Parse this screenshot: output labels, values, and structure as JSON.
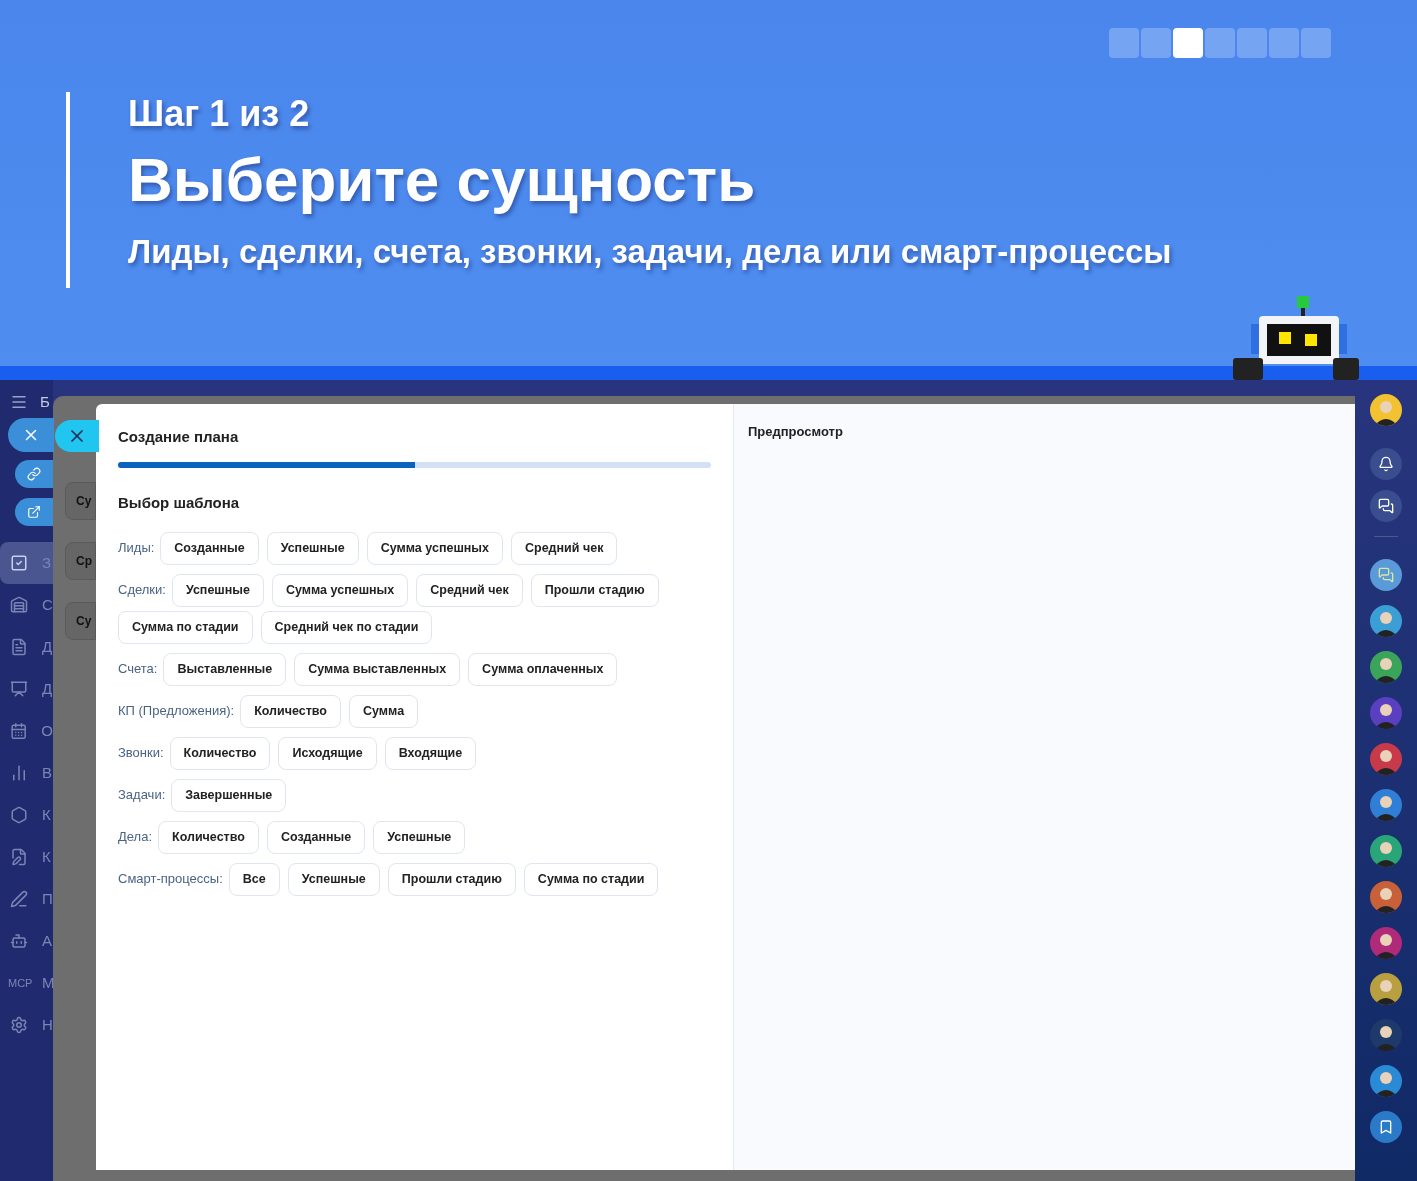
{
  "banner": {
    "step": "Шаг 1 из 2",
    "title": "Выберите сущность",
    "subtitle": "Лиды, сделки, счета, звонки, задачи, дела или смарт-процессы",
    "slides": [
      {
        "selected": false
      },
      {
        "selected": false
      },
      {
        "selected": true
      },
      {
        "selected": false
      },
      {
        "selected": false
      },
      {
        "selected": false
      },
      {
        "selected": false
      }
    ]
  },
  "sidebar": {
    "header": "Б",
    "items": [
      {
        "label": "З",
        "selected": true
      },
      {
        "label": "С",
        "selected": false
      },
      {
        "label": "Д",
        "selected": false
      },
      {
        "label": "Д",
        "selected": false
      },
      {
        "label": "О",
        "selected": false
      },
      {
        "label": "В",
        "selected": false
      },
      {
        "label": "К",
        "selected": false
      },
      {
        "label": "К",
        "selected": false
      },
      {
        "label": "П",
        "selected": false
      },
      {
        "label": "А",
        "selected": false
      },
      {
        "label": "М",
        "icon_text": "MCP",
        "selected": false
      },
      {
        "label": "Н",
        "selected": false
      }
    ]
  },
  "background_cards": [
    "Су",
    "Ср",
    "Су"
  ],
  "modal": {
    "title": "Создание плана",
    "progress": {
      "level": 0.5
    },
    "section": "Выбор шаблона",
    "groups": [
      {
        "label": "Лиды:",
        "options": [
          "Созданные",
          "Успешные",
          "Сумма успешных",
          "Средний чек"
        ]
      },
      {
        "label": "Сделки:",
        "options": [
          "Успешные",
          "Сумма успешных",
          "Средний чек",
          "Прошли стадию",
          "Сумма по стадии",
          "Средний чек по стадии"
        ]
      },
      {
        "label": "Счета:",
        "options": [
          "Выставленные",
          "Сумма выставленных",
          "Сумма оплаченных"
        ]
      },
      {
        "label": "КП (Предложения):",
        "options": [
          "Количество",
          "Сумма"
        ]
      },
      {
        "label": "Звонки:",
        "options": [
          "Количество",
          "Исходящие",
          "Входящие"
        ]
      },
      {
        "label": "Задачи:",
        "options": [
          "Завершенные"
        ]
      },
      {
        "label": "Дела:",
        "options": [
          "Количество",
          "Созданные",
          "Успешные"
        ]
      },
      {
        "label": "Смарт-процессы:",
        "options": [
          "Все",
          "Успешные",
          "Прошли стадию",
          "Сумма по стадии"
        ]
      }
    ]
  },
  "preview": {
    "title": "Предпросмотр"
  },
  "right_rail": {
    "contacts": [
      {
        "color": "#3b9fd6"
      },
      {
        "color": "#3aa55a"
      },
      {
        "color": "#5a3fc0"
      },
      {
        "color": "#c83a4a"
      },
      {
        "color": "#2f7fd6"
      },
      {
        "color": "#2aa57a"
      },
      {
        "color": "#c8603a"
      },
      {
        "color": "#b02a7a"
      },
      {
        "color": "#b8a040"
      },
      {
        "color": "#1e3a6a"
      },
      {
        "color": "#2a8ad6"
      }
    ]
  }
}
